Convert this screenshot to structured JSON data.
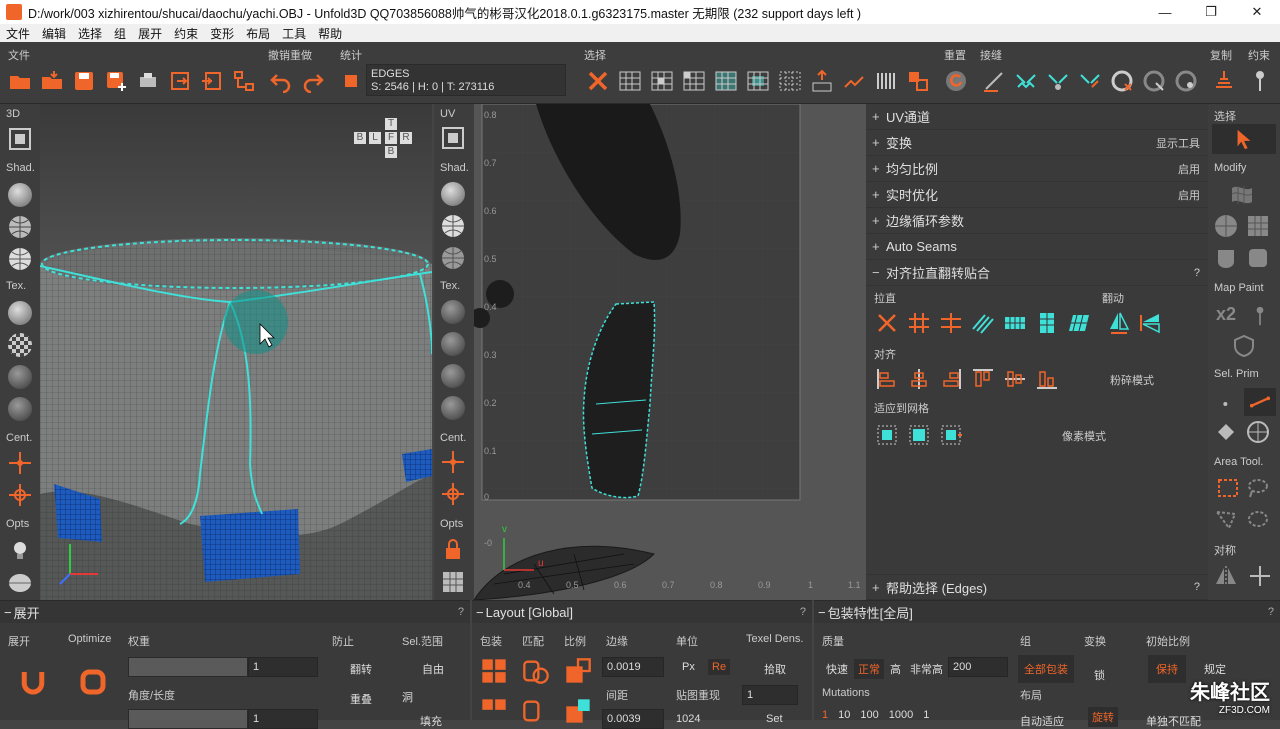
{
  "window": {
    "title": "D:/work/003 xizhirentou/shucai/daochu/yachi.OBJ - Unfold3D QQ703856088帅气的彬哥汉化2018.0.1.g6323175.master 无期限 (232 support days left )",
    "min": "—",
    "restore": "❐",
    "close": "✕"
  },
  "menu": [
    "文件",
    "编辑",
    "选择",
    "组",
    "展开",
    "约束",
    "变形",
    "布局",
    "工具",
    "帮助"
  ],
  "toolbar": {
    "groups": {
      "file": "文件",
      "undo": "撤销重做",
      "stats": "统计",
      "select": "选择",
      "reset": "重置",
      "stitch": "接缝",
      "copy": "复制",
      "constrain": "约束"
    },
    "info": {
      "mode": "EDGES",
      "stats": "S: 2546 | H: 0 | T: 273116"
    }
  },
  "left_strip": {
    "view": "3D",
    "shad": "Shad.",
    "tex": "Tex.",
    "cent": "Cent.",
    "opts": "Opts"
  },
  "uv_strip": {
    "view": "UV",
    "shad": "Shad.",
    "tex": "Tex.",
    "cent": "Cent.",
    "opts": "Opts"
  },
  "view_cube": {
    "top": "T",
    "b1": "B",
    "l": "L",
    "f": "F",
    "r": "R",
    "b2": "B"
  },
  "uv_ticks": {
    "y": [
      "0.8",
      "0.7",
      "0.6",
      "0.5",
      "0.4",
      "0.3",
      "0.2",
      "0.1",
      "0"
    ],
    "x": [
      "0.4",
      "0.5",
      "0.6",
      "0.7",
      "0.8",
      "0.9",
      "1",
      "1.1"
    ],
    "neg": "-0"
  },
  "axes": {
    "x": "u",
    "y": "v"
  },
  "props": {
    "sections": [
      {
        "label": "UV通道",
        "right": ""
      },
      {
        "label": "变换",
        "right": "显示工具"
      },
      {
        "label": "均匀比例",
        "right": "启用"
      },
      {
        "label": "实时优化",
        "right": "启用"
      },
      {
        "label": "边缘循环参数",
        "right": ""
      },
      {
        "label": "Auto Seams",
        "right": ""
      }
    ],
    "align_section": "对齐拉直翻转贴合",
    "straighten": "拉直",
    "flip": "翻动",
    "align": "对齐",
    "shatter": "粉碎模式",
    "fit_grid": "适应到网格",
    "pixel_mode": "像素模式",
    "help": "帮助选择 (Edges)",
    "q": "?"
  },
  "rcol": {
    "select": "选择",
    "modify": "Modify",
    "map_paint": "Map Paint",
    "x2": "x2",
    "sel_prim": "Sel. Prim",
    "area_tool": "Area Tool.",
    "symmetry": "对称"
  },
  "bottom": {
    "unfold": {
      "title": "展开",
      "labels": {
        "unfold": "展开",
        "optimize": "Optimize",
        "weight": "权重",
        "prevent": "防止",
        "sel_range": "Sel.范围",
        "angle": "角度/长度",
        "flip": "翻转",
        "free": "自由",
        "overlap": "重叠",
        "hole": "洞",
        "fill": "填充"
      },
      "weight_value": "1",
      "angle_value": "1"
    },
    "layout": {
      "title": "Layout [Global]",
      "labels": {
        "pack": "包装",
        "match": "匹配",
        "ratio": "比例",
        "margin": "边缘",
        "unit": "单位",
        "texel": "Texel Dens.",
        "spacing": "间距",
        "tile": "贴图重现",
        "px": "Px",
        "re": "Re",
        "pick": "拾取",
        "set": "Set"
      },
      "margin_value": "0.0019",
      "spacing_value": "0.0039",
      "tile_value": "1",
      "res_value": "1024"
    },
    "packing": {
      "title": "包装特性[全局]",
      "labels": {
        "quality": "质量",
        "group": "组",
        "transform": "变换",
        "init_scale": "初始比例",
        "fast": "快速",
        "normal": "正常",
        "high": "高",
        "very_high": "非常高",
        "mutations": "Mutations",
        "all_pack": "全部包装",
        "lock": "锁",
        "keep": "保持",
        "fixed": "规定",
        "layout": "布局",
        "auto_adapt": "自动适应",
        "rotate": "旋转",
        "no_unify": "单独不匹配"
      },
      "value": "200",
      "mut_values": [
        "1",
        "10",
        "100",
        "1000",
        "1"
      ]
    }
  },
  "watermark": {
    "main": "朱峰社区",
    "sub": "ZF3D.COM"
  },
  "colors": {
    "accent": "#f0652a",
    "seam": "#3fe0d8",
    "uv_selected": "#2b2b2b"
  }
}
